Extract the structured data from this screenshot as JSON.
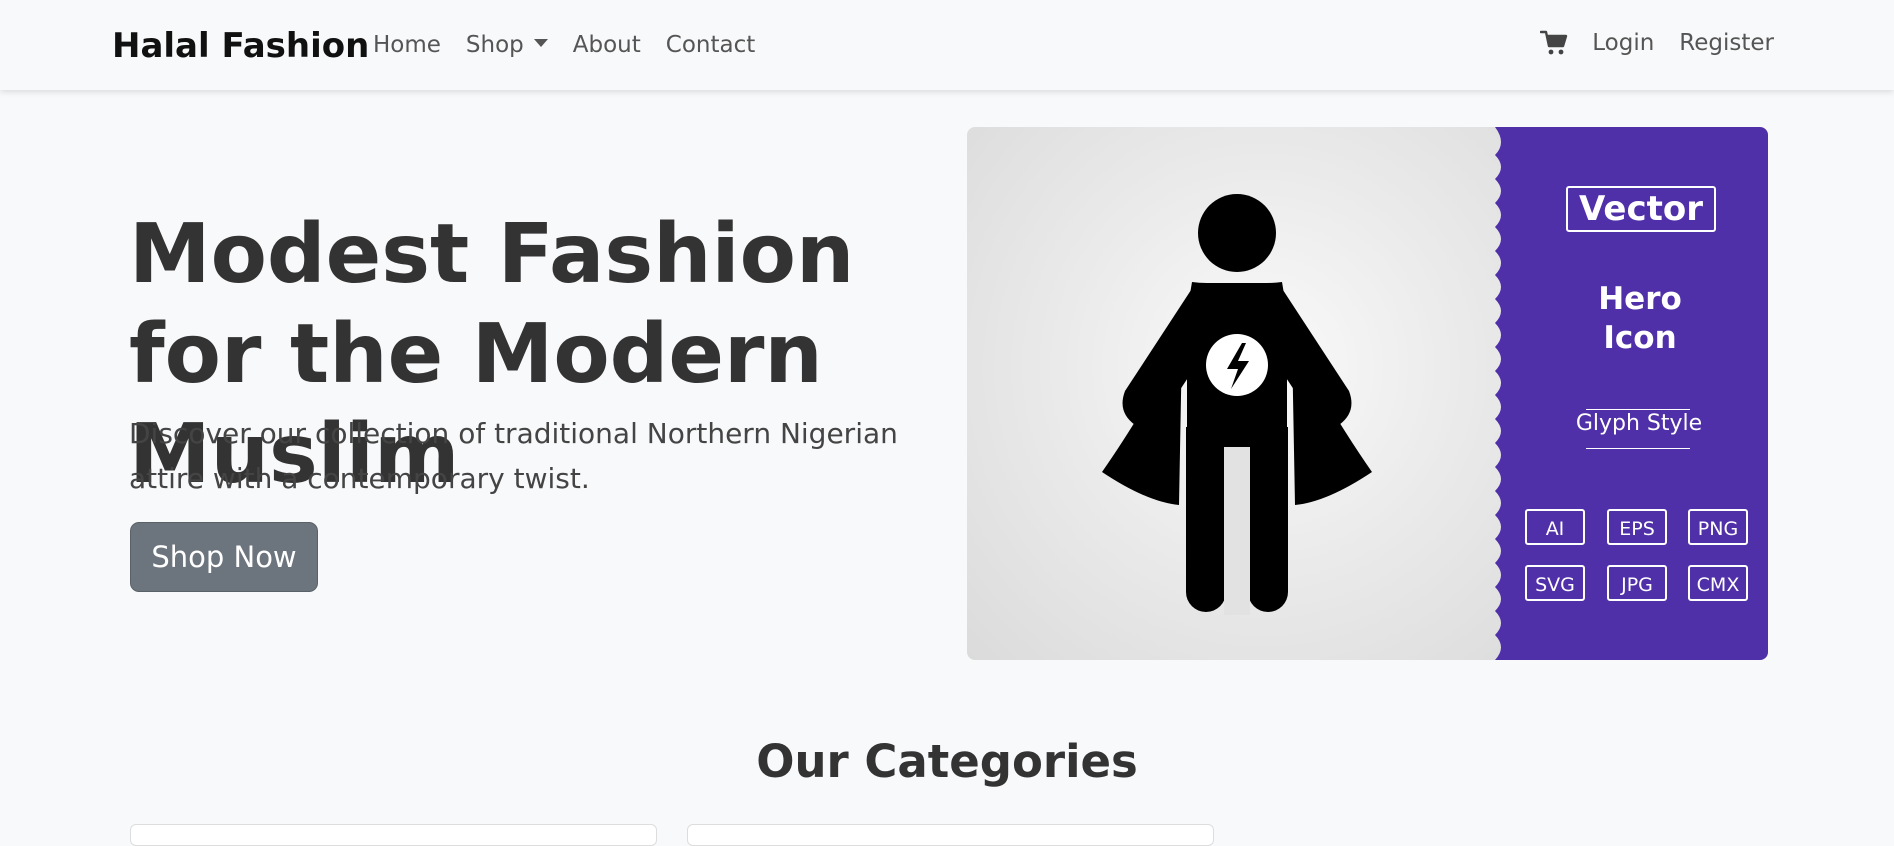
{
  "navbar": {
    "brand": "Halal Fashion",
    "links": [
      {
        "label": "Home"
      },
      {
        "label": "Shop"
      },
      {
        "label": "About"
      },
      {
        "label": "Contact"
      }
    ],
    "cart_icon": "cart-icon",
    "login": "Login",
    "register": "Register"
  },
  "hero": {
    "title": "Modest Fashion for the Modern Muslim",
    "subtitle": "Discover our collection of traditional Northern Nigerian attire with a contemporary twist.",
    "cta": "Shop Now",
    "image": {
      "vector_label": "Vector",
      "icon_title_line1": "Hero",
      "icon_title_line2": "Icon",
      "style_label": "Glyph Style",
      "formats": [
        "AI",
        "EPS",
        "PNG",
        "SVG",
        "JPG",
        "CMX"
      ],
      "panel_color": "#5030a8",
      "figure_icon": "superhero-icon"
    }
  },
  "categories": {
    "title": "Our Categories"
  }
}
